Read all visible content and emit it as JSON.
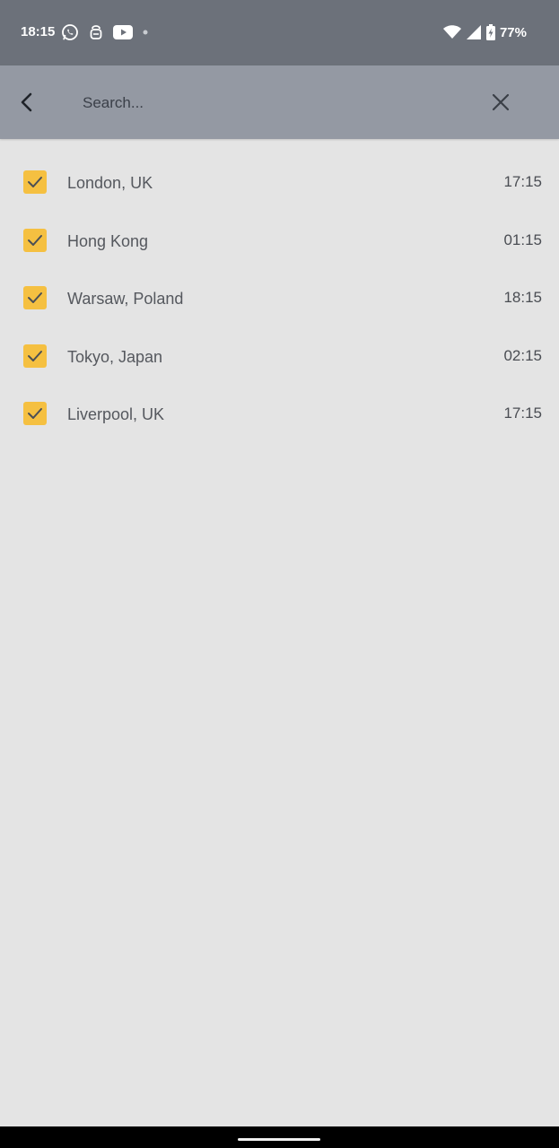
{
  "status_bar": {
    "time": "18:15",
    "battery": "77%",
    "icons_left": [
      "whatsapp-icon",
      "vpn-lock-icon",
      "youtube-icon",
      "notification-dot-icon"
    ],
    "icons_right": [
      "wifi-icon",
      "signal-icon",
      "battery-charging-icon"
    ]
  },
  "search": {
    "placeholder": "Search...",
    "value": ""
  },
  "colors": {
    "status_bar_bg": "#6c717a",
    "toolbar_bg": "#9499a3",
    "page_bg": "#e4e4e4",
    "checkbox_fill": "#f5c041"
  },
  "cities": [
    {
      "name": "London, UK",
      "time": "17:15",
      "checked": true
    },
    {
      "name": "Hong Kong",
      "time": "01:15",
      "checked": true
    },
    {
      "name": "Warsaw, Poland",
      "time": "18:15",
      "checked": true
    },
    {
      "name": "Tokyo, Japan",
      "time": "02:15",
      "checked": true
    },
    {
      "name": "Liverpool, UK",
      "time": "17:15",
      "checked": true
    }
  ]
}
